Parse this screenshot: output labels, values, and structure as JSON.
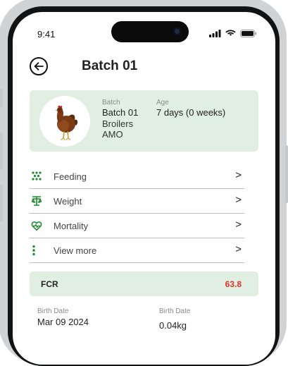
{
  "status_bar": {
    "time": "9:41"
  },
  "header": {
    "title": "Batch 01"
  },
  "batch_card": {
    "batch_label": "Batch",
    "batch_value": "Batch 01",
    "type": "Broilers",
    "farm": "AMO",
    "age_label": "Age",
    "age_value": "7 days (0 weeks)"
  },
  "menu": [
    {
      "label": "Feeding",
      "icon": "feeding-icon",
      "chevron": ">"
    },
    {
      "label": "Weight",
      "icon": "scale-icon",
      "chevron": ">"
    },
    {
      "label": "Mortality",
      "icon": "heart-health-icon",
      "chevron": ">"
    },
    {
      "label": "View more",
      "icon": "more-vertical-icon",
      "chevron": ">"
    }
  ],
  "fcr": {
    "label": "FCR",
    "value": "63.8"
  },
  "details": {
    "left_label": "Birth Date",
    "left_value": "Mar 09 2024",
    "right_label": "Birth Date",
    "right_value": "0.04kg"
  },
  "colors": {
    "accent_green": "#1f8a2f",
    "card_bg": "#e1efe2",
    "fcr_red": "#e0322c"
  }
}
